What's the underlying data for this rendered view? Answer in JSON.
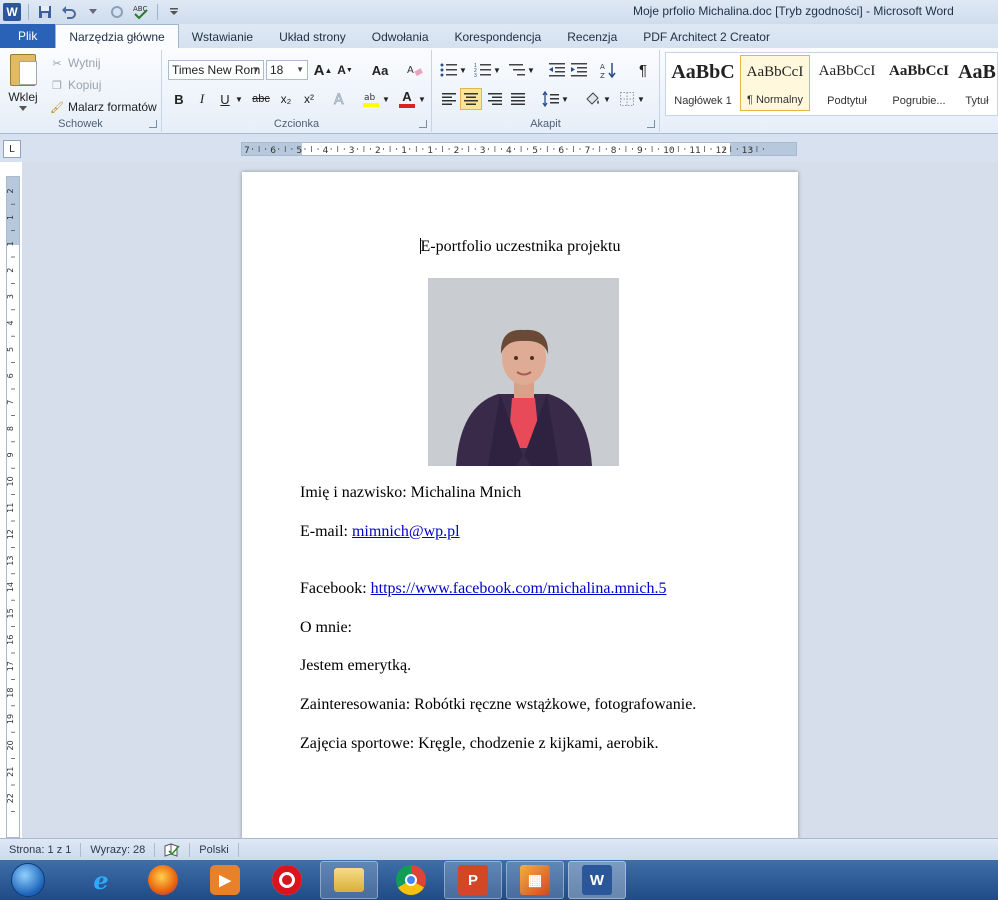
{
  "window": {
    "title": "Moje prfolio Michalina.doc [Tryb zgodności]  -  Microsoft Word",
    "app_icon_letter": "W"
  },
  "tabs": [
    {
      "label": "Plik"
    },
    {
      "label": "Narzędzia główne"
    },
    {
      "label": "Wstawianie"
    },
    {
      "label": "Układ strony"
    },
    {
      "label": "Odwołania"
    },
    {
      "label": "Korespondencja"
    },
    {
      "label": "Recenzja"
    },
    {
      "label": "PDF Architect 2 Creator"
    }
  ],
  "ribbon": {
    "clipboard": {
      "group_label": "Schowek",
      "paste_label": "Wklej",
      "cut_label": "Wytnij",
      "copy_label": "Kopiuj",
      "format_painter_label": "Malarz formatów"
    },
    "font": {
      "group_label": "Czcionka",
      "font_name": "Times New Rom",
      "font_size": "18",
      "grow_label": "A",
      "shrink_label": "A",
      "case_label": "Aa",
      "bold": "B",
      "italic": "I",
      "underline": "U",
      "strike": "abc",
      "subscript": "x₂",
      "superscript": "x²",
      "font_color_label": "A"
    },
    "paragraph": {
      "group_label": "Akapit",
      "pilcrow": "¶"
    },
    "styles": [
      {
        "sample": "AaBbC",
        "name": "Nagłówek 1"
      },
      {
        "sample": "AaBbCcI",
        "name": "¶ Normalny"
      },
      {
        "sample": "AaBbCcI",
        "name": "Podtytuł"
      },
      {
        "sample": "AaBbCcI",
        "name": "Pogrubie..."
      },
      {
        "sample": "AaB",
        "name": "Tytuł"
      }
    ]
  },
  "ruler": {
    "labels": [
      "7",
      "6",
      "5",
      "4",
      "3",
      "2",
      "1",
      "1",
      "2",
      "3",
      "4",
      "5",
      "6",
      "7",
      "8",
      "9",
      "10",
      "11",
      "12",
      "13"
    ],
    "vertical_labels": [
      "2",
      "1",
      "1",
      "2",
      "3",
      "4",
      "5",
      "6",
      "7",
      "8",
      "9",
      "10",
      "11",
      "12",
      "13",
      "14",
      "15",
      "16",
      "17",
      "18",
      "19",
      "20",
      "21",
      "22"
    ],
    "tab_selector": "L"
  },
  "document": {
    "title": "E-portfolio uczestnika projektu",
    "name_line": "Imię i nazwisko: Michalina Mnich",
    "email_prefix": "E-mail: ",
    "email": "mimnich@wp.pl",
    "facebook_prefix": "Facebook: ",
    "facebook_url": "https://www.facebook.com/michalina.mnich.5",
    "about_heading": "O mnie:",
    "about_text": "Jestem emerytką.",
    "interests": "Zainteresowania: Robótki ręczne wstążkowe, fotografowanie.",
    "sports": "Zajęcia sportowe: Kręgle, chodzenie z kijkami, aerobik."
  },
  "status": {
    "page": "Strona: 1 z 1",
    "words": "Wyrazy: 28",
    "language": "Polski"
  },
  "colors": {
    "word_blue": "#2b579a",
    "file_tab": "#2a62b8",
    "link": "#0000cc",
    "taskbar": "#1f4b86"
  }
}
